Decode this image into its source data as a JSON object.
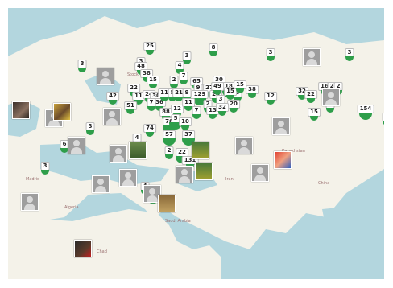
{
  "cluster_labels": [
    "25",
    "3",
    "3",
    "4",
    "8",
    "3",
    "3",
    "3",
    "48",
    "38",
    "15",
    "22",
    "2",
    "7",
    "65",
    "30",
    "9",
    "27",
    "28",
    "18",
    "3",
    "11",
    "24",
    "30",
    "36",
    "11",
    "5",
    "21",
    "9",
    "129",
    "49",
    "15",
    "15",
    "38",
    "12",
    "32",
    "22",
    "16",
    "2",
    "2",
    "15",
    "42",
    "51",
    "7",
    "88",
    "12",
    "11",
    "7",
    "2",
    "3",
    "20",
    "13",
    "32",
    "2",
    "154",
    "2",
    "3",
    "74",
    "76",
    "5",
    "10",
    "37",
    "57",
    "6",
    "4",
    "2",
    "22",
    "131",
    "3",
    "4",
    "3",
    "4"
  ],
  "avatar_kinds": [
    "generic-user",
    "photo-dark-face",
    "photo-yellow-shirt",
    "photo-green-field",
    "photo-red-art",
    "photo-desert",
    "photo-dark-portrait"
  ],
  "colors": {
    "sea": "#b3d6de",
    "land": "#f4f2e9",
    "cluster_pin": "#2e9e4a",
    "avatar_bg": "#9e9e9e"
  }
}
